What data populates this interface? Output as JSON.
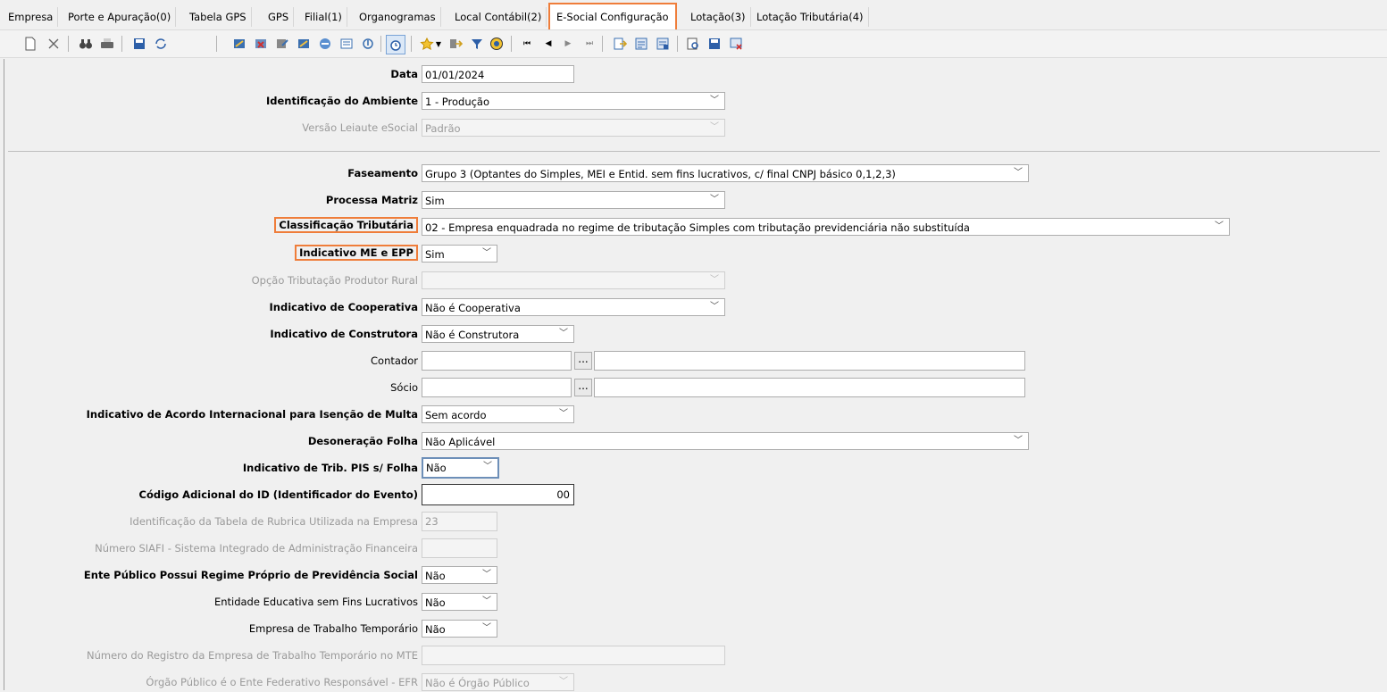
{
  "tabs": [
    {
      "label": "Empresa"
    },
    {
      "label": "Porte e Apuração(0)"
    },
    {
      "label": "Tabela GPS"
    },
    {
      "label": "GPS"
    },
    {
      "label": "Filial(1)"
    },
    {
      "label": "Organogramas"
    },
    {
      "label": "Local Contábil(2)"
    },
    {
      "label": "E-Social Configuração",
      "active": true
    },
    {
      "label": "Lotação(3)"
    },
    {
      "label": "Lotação Tributária(4)"
    }
  ],
  "toolbar_icons": [
    "new-icon",
    "delete-icon",
    "find-icon",
    "print-icon",
    "save-icon",
    "refresh-icon",
    "icon-a",
    "icon-b",
    "icon-c",
    "icon-d",
    "icon-e",
    "icon-f",
    "icon-g",
    "timer-icon",
    "favorite-icon",
    "exit-icon",
    "filter-icon",
    "help-icon",
    "first-icon",
    "prev-icon",
    "next-icon",
    "last-icon",
    "export-icon",
    "report-icon",
    "report2-icon",
    "preview-icon",
    "print2-icon",
    "close-report-icon"
  ],
  "form": {
    "data": {
      "label": "Data",
      "value": "01/01/2024"
    },
    "ambiente": {
      "label": "Identificação do Ambiente",
      "value": "1 - Produção"
    },
    "versao": {
      "label": "Versão Leiaute eSocial",
      "value": "Padrão"
    },
    "faseamento": {
      "label": "Faseamento",
      "value": "Grupo 3 (Optantes do Simples, MEI e Entid. sem fins lucrativos, c/ final CNPJ básico 0,1,2,3)"
    },
    "processa_matriz": {
      "label": "Processa Matriz",
      "value": "Sim"
    },
    "classificacao": {
      "label": "Classificação Tributária",
      "value": "02 - Empresa enquadrada no regime de tributação Simples com tributação previdenciária não substituída"
    },
    "indicativo_me": {
      "label": "Indicativo ME e EPP",
      "value": "Sim"
    },
    "opcao_produtor": {
      "label": "Opção Tributação Produtor Rural",
      "value": ""
    },
    "cooperativa": {
      "label": "Indicativo de Cooperativa",
      "value": "Não é Cooperativa"
    },
    "construtora": {
      "label": "Indicativo de Construtora",
      "value": "Não é Construtora"
    },
    "contador": {
      "label": "Contador",
      "value": ""
    },
    "socio": {
      "label": "Sócio",
      "value": ""
    },
    "acordo": {
      "label": "Indicativo de Acordo Internacional para Isenção de Multa",
      "value": "Sem acordo"
    },
    "desoneracao": {
      "label": "Desoneração Folha",
      "value": "Não Aplicável"
    },
    "trib_pis": {
      "label": "Indicativo de Trib. PIS s/ Folha",
      "value": "Não"
    },
    "codigo_id": {
      "label": "Código Adicional do ID (Identificador do Evento)",
      "value": "00"
    },
    "tabela_rubrica": {
      "label": "Identificação da Tabela de Rubrica Utilizada na Empresa",
      "value": "23"
    },
    "siafi": {
      "label": "Número SIAFI - Sistema Integrado de Administração Financeira",
      "value": ""
    },
    "ente_publico": {
      "label": "Ente Público Possui Regime Próprio de Previdência Social",
      "value": "Não"
    },
    "educativa": {
      "label": "Entidade Educativa sem Fins Lucrativos",
      "value": "Não"
    },
    "trabalho_temp": {
      "label": "Empresa de Trabalho Temporário",
      "value": "Não"
    },
    "registro_mte": {
      "label": "Número do Registro da Empresa de Trabalho Temporário no MTE",
      "value": ""
    },
    "orgao_publico": {
      "label": "Órgão Público é o Ente Federativo Responsável - EFR",
      "value": "Não é Órgão Público"
    }
  },
  "ellipsis": "...",
  "colors": {
    "highlight": "#ef7d3a",
    "focus": "#6d8fb8"
  }
}
